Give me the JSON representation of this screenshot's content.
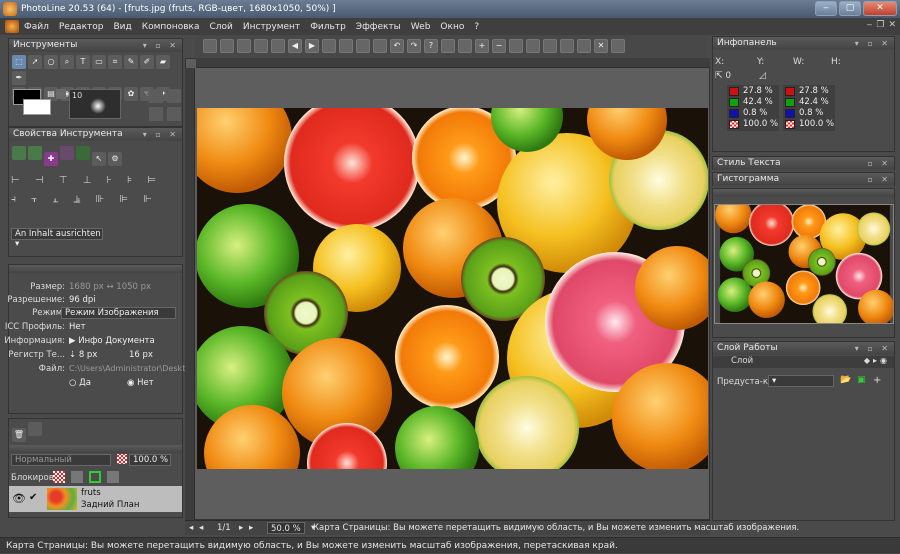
{
  "window": {
    "title": "PhotoLine 20.53 (64) - [fruts.jpg (fruts, RGB-цвет, 1680x1050, 50%) ]",
    "controls": {
      "minimize": "‒",
      "maximize": "▢",
      "close": "✕"
    }
  },
  "menu": {
    "items": [
      "Файл",
      "Редактор",
      "Вид",
      "Компоновка",
      "Слой",
      "Инструмент",
      "Фильтр",
      "Эффекты",
      "Web",
      "Окно",
      "?"
    ],
    "mdi_controls": {
      "minimize": "‒",
      "restore": "❐",
      "close": "✕"
    }
  },
  "tools_panel": {
    "title": "Инструменты",
    "brush_size": "10"
  },
  "tool_props": {
    "title": "Свойства Инструмента",
    "align_select": "An Inhalt ausrichten"
  },
  "doc_info": {
    "rows": [
      {
        "label": "Размер:",
        "value": "1680 px  ↔  1050 px"
      },
      {
        "label": "Разрешение:",
        "value": "96 dpi"
      },
      {
        "label": "Режим:",
        "value": "Режим Изображения"
      },
      {
        "label": "ICC Профиль:",
        "value": "Нет"
      },
      {
        "label": "Информация:",
        "value": "▶ Инфо Документа"
      },
      {
        "label": "Регистр Те...",
        "value": "⇣ 8 px"
      },
      {
        "label": "Файл:",
        "value": "C:\\Users\\Administrator\\Desktop\\fru"
      }
    ],
    "register_second": "16 px",
    "radio_yes": "Да",
    "radio_no": "Нет"
  },
  "layers_panel": {
    "blend_mode": "Нормальный",
    "opacity": "100.0 %",
    "lock_label": "Блокировк:",
    "layer_name": "fruts",
    "layer_sub": "Задний План"
  },
  "info_panel": {
    "title": "Инфопанель",
    "labels": {
      "x": "X:",
      "y": "Y:",
      "w": "W:",
      "h": "H:",
      "zero": "0"
    },
    "left_values": [
      "27.8 %",
      "42.4 %",
      "0.8 %",
      "100.0 %"
    ],
    "right_values": [
      "27.8 %",
      "42.4 %",
      "0.8 %",
      "100.0 %"
    ]
  },
  "text_style_panel": {
    "title": "Стиль Текста"
  },
  "histogram_panel": {
    "title": "Гистограмма"
  },
  "workspace_panel": {
    "title": "Слой Работы",
    "layer_label": "Слой",
    "presets_label": "Предуста-ки:"
  },
  "page_bar": {
    "page": "1/1",
    "zoom": "50.0 %",
    "message": "Карта Страницы: Вы можете перетащить видимую область, и Вы можете изменить масштаб изображения."
  },
  "status": {
    "text": "Карта Страницы: Вы можете перетащить видимую область, и Вы можете изменить масштаб изображения, перетаскивая край."
  },
  "colors": {
    "accent": "#6b7d94",
    "panel": "#4b4b4b",
    "canvas_bg": "#5e5e5e"
  }
}
